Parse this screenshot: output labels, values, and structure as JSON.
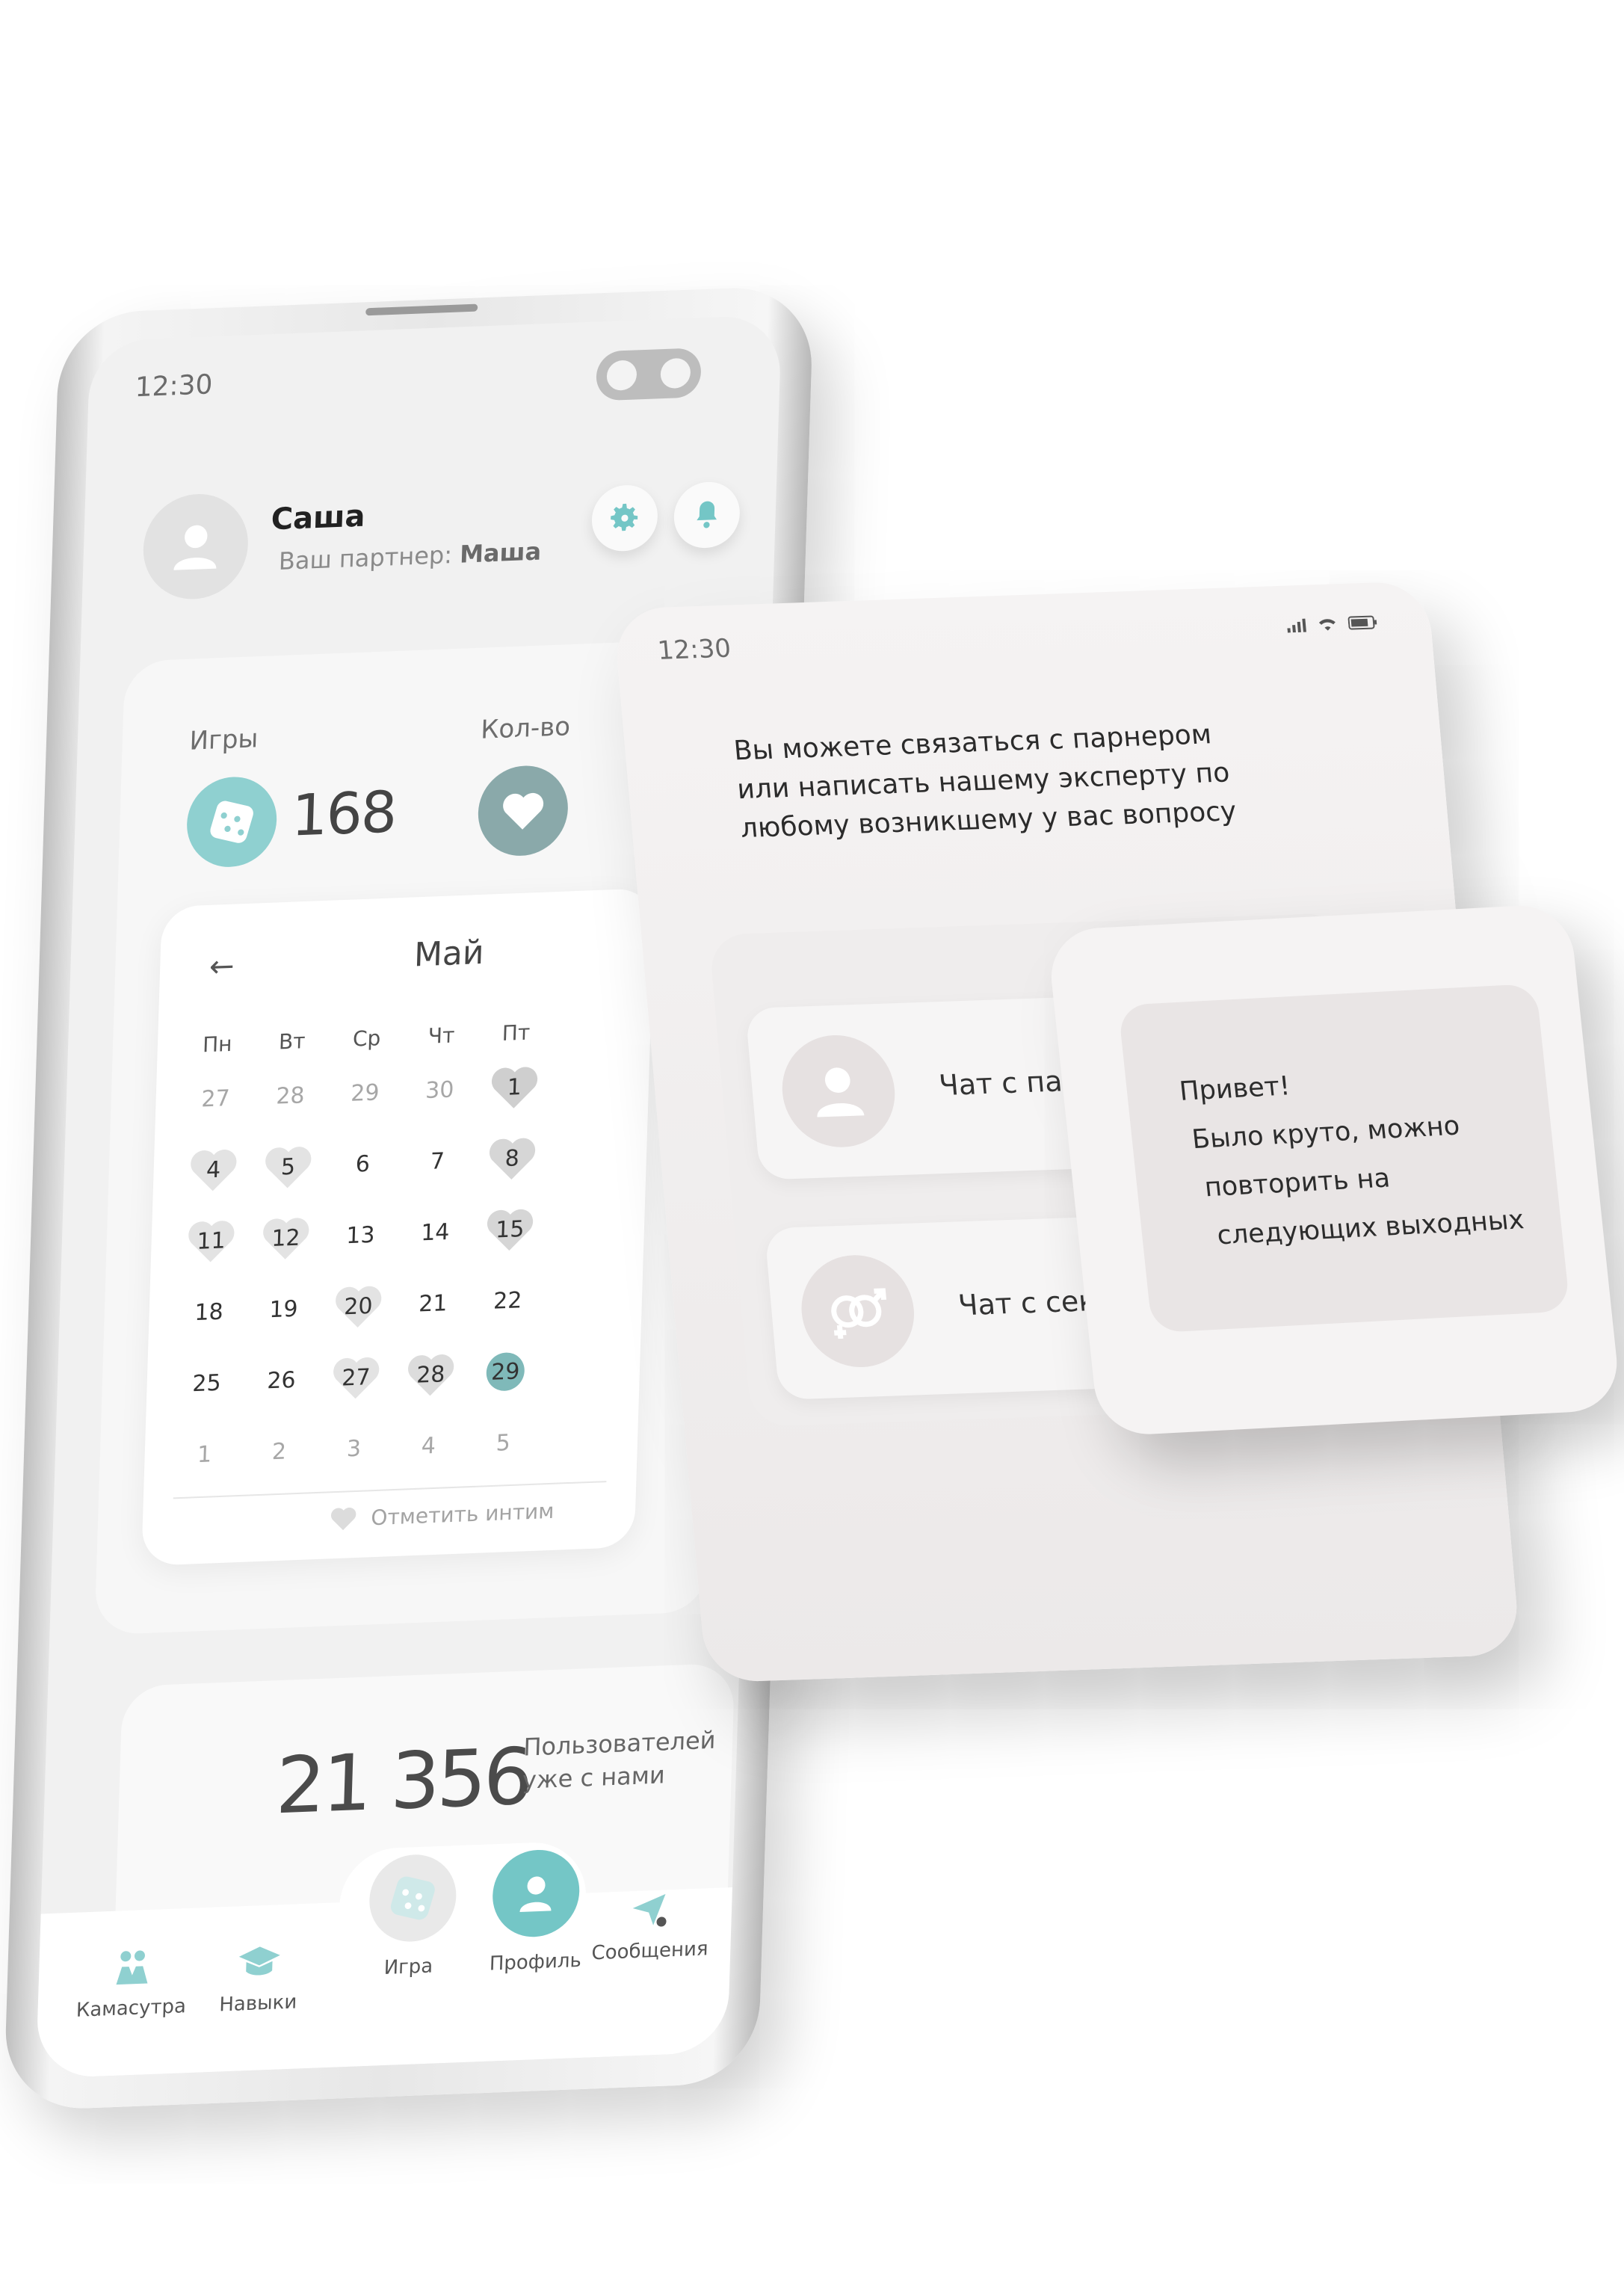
{
  "phone": {
    "status_time": "12:30",
    "user_name": "Саша",
    "partner_label": "Ваш партнер:",
    "partner_name": "Маша",
    "games_label": "Игры",
    "games_count": "168",
    "count_label": "Кол-во",
    "calendar": {
      "month": "Май",
      "weekdays": [
        "Пн",
        "Вт",
        "Ср",
        "Чт",
        "Пт"
      ],
      "mark_label": "Отметить интим"
    },
    "users_count": "21 356",
    "users_text_1": "Пользователей",
    "users_text_2": "уже с нами",
    "nav": {
      "kamasutra": "Камасутра",
      "skills": "Навыки",
      "game": "Игра",
      "profile": "Профиль",
      "messages": "Сообщения"
    }
  },
  "days": [
    [
      "27",
      "28",
      "29",
      "30",
      "1"
    ],
    [
      "4",
      "5",
      "6",
      "7",
      "8"
    ],
    [
      "11",
      "12",
      "13",
      "14",
      "15"
    ],
    [
      "18",
      "19",
      "20",
      "21",
      "22"
    ],
    [
      "25",
      "26",
      "27",
      "28",
      "29"
    ],
    [
      "1",
      "2",
      "3",
      "4",
      "5"
    ]
  ],
  "chat_card": {
    "status_time": "12:30",
    "intro": "Вы можете связаться с парнером или написать нашему эксперту по любому возникшему у вас вопросу",
    "chat_partner": "Чат с партнером",
    "chat_sexologist": "Чат с сексологом"
  },
  "message_card": {
    "line1": "Привет!",
    "line2": "Было круто, можно",
    "line3": "повторить на",
    "line4": "следующих выходных"
  },
  "colors": {
    "accent": "#74c6c6",
    "accent_light": "#8fd0d0",
    "heart": "#dedede",
    "card": "#f5f3f3"
  }
}
